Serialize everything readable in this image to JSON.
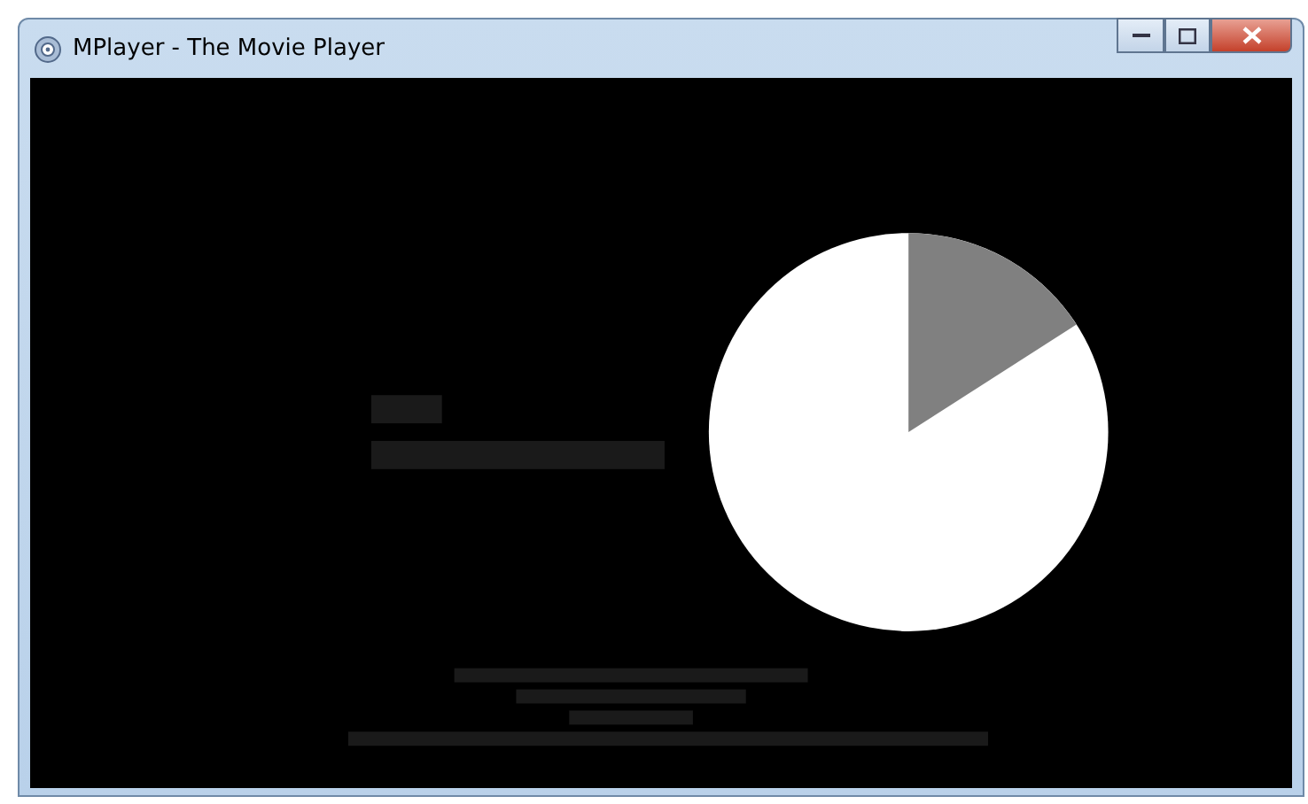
{
  "window": {
    "title": "MPlayer - The Movie Player"
  }
}
